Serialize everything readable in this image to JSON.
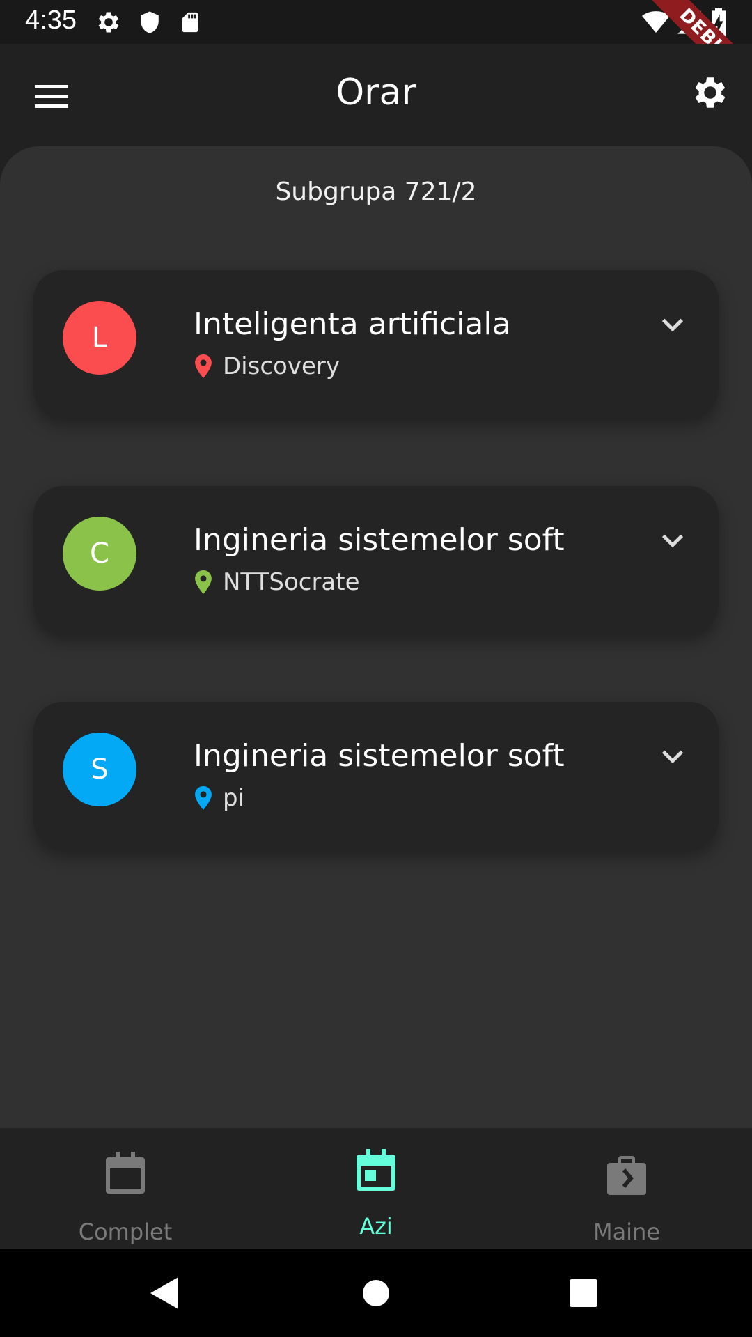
{
  "status_bar": {
    "time": "4:35",
    "icons": [
      "gear-icon",
      "shield-icon",
      "sd-card-icon",
      "wifi-icon",
      "cellular-icon",
      "battery-charging-icon"
    ],
    "debug_label": "DEBUG"
  },
  "app_bar": {
    "title": "Orar",
    "menu_icon": "menu-icon",
    "settings_icon": "settings-icon"
  },
  "subgroup_label": "Subgrupa 721/2",
  "courses": [
    {
      "initial": "L",
      "title": "Inteligenta artificiala",
      "location": "Discovery",
      "color": "#fb4d4f"
    },
    {
      "initial": "C",
      "title": "Ingineria sistemelor soft",
      "location": "NTTSocrate",
      "color": "#8bc34a"
    },
    {
      "initial": "S",
      "title": "Ingineria sistemelor soft",
      "location": "pi",
      "color": "#03a9f4"
    }
  ],
  "bottom_nav": {
    "items": [
      {
        "label": "Complet",
        "icon": "calendar-blank-icon",
        "active": false
      },
      {
        "label": "Azi",
        "icon": "calendar-today-icon",
        "active": true
      },
      {
        "label": "Maine",
        "icon": "next-week-icon",
        "active": false
      }
    ],
    "active_color": "#64ffda",
    "inactive_color": "#7a7a7a"
  },
  "system_nav": [
    "back-icon",
    "home-icon",
    "recents-icon"
  ]
}
